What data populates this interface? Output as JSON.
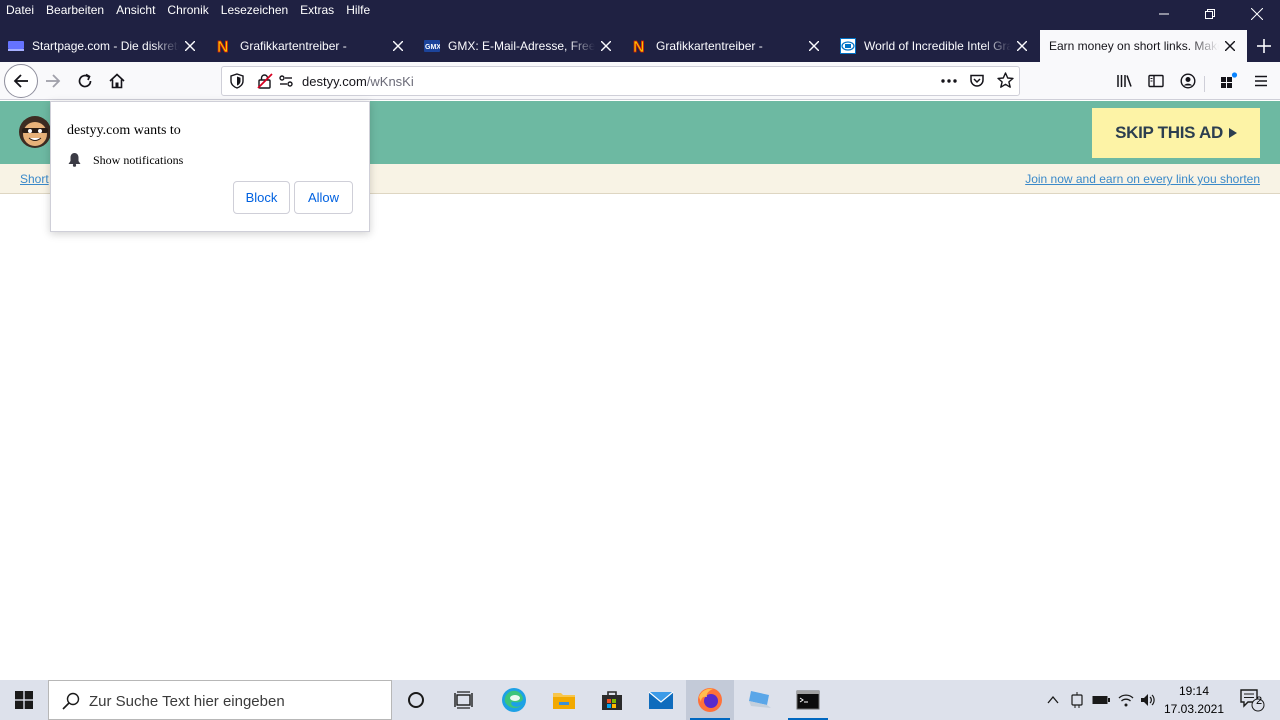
{
  "menu": [
    "Datei",
    "Bearbeiten",
    "Ansicht",
    "Chronik",
    "Lesezeichen",
    "Extras",
    "Hilfe"
  ],
  "tabs": [
    {
      "title": "Startpage.com - Die diskrete Suchmaschine",
      "favicon": "startpage-icon"
    },
    {
      "title": "Grafikkartentreiber -",
      "favicon": "n-logo-icon"
    },
    {
      "title": "GMX: E-Mail-Adresse, FreeMail",
      "favicon": "gmx-icon"
    },
    {
      "title": "Grafikkartentreiber -",
      "favicon": "n-logo-icon"
    },
    {
      "title": "World of Incredible Intel Graphics",
      "favicon": "intel-icon"
    },
    {
      "title": "Earn money on short links. Make",
      "favicon": "none"
    }
  ],
  "address": {
    "host": "destyy.com",
    "path": "/wKnsKi"
  },
  "page": {
    "skip_ad": "SKIP THIS AD",
    "shorten_link": "Short",
    "join_link": "Join now and earn on every link you shorten"
  },
  "notification": {
    "title": "destyy.com wants to",
    "permission": "Show notifications",
    "block": "Block",
    "allow": "Allow"
  },
  "taskbar": {
    "search_placeholder": "Zur Suche Text hier eingeben",
    "time": "19:14",
    "date": "17.03.2021",
    "notification_count": "2"
  },
  "colors": {
    "titlebar": "#1f2142",
    "banner": "#6db9a2",
    "skip_ad_bg": "#fdf3a6",
    "link": "#3a89c9",
    "accent": "#0061e0"
  }
}
